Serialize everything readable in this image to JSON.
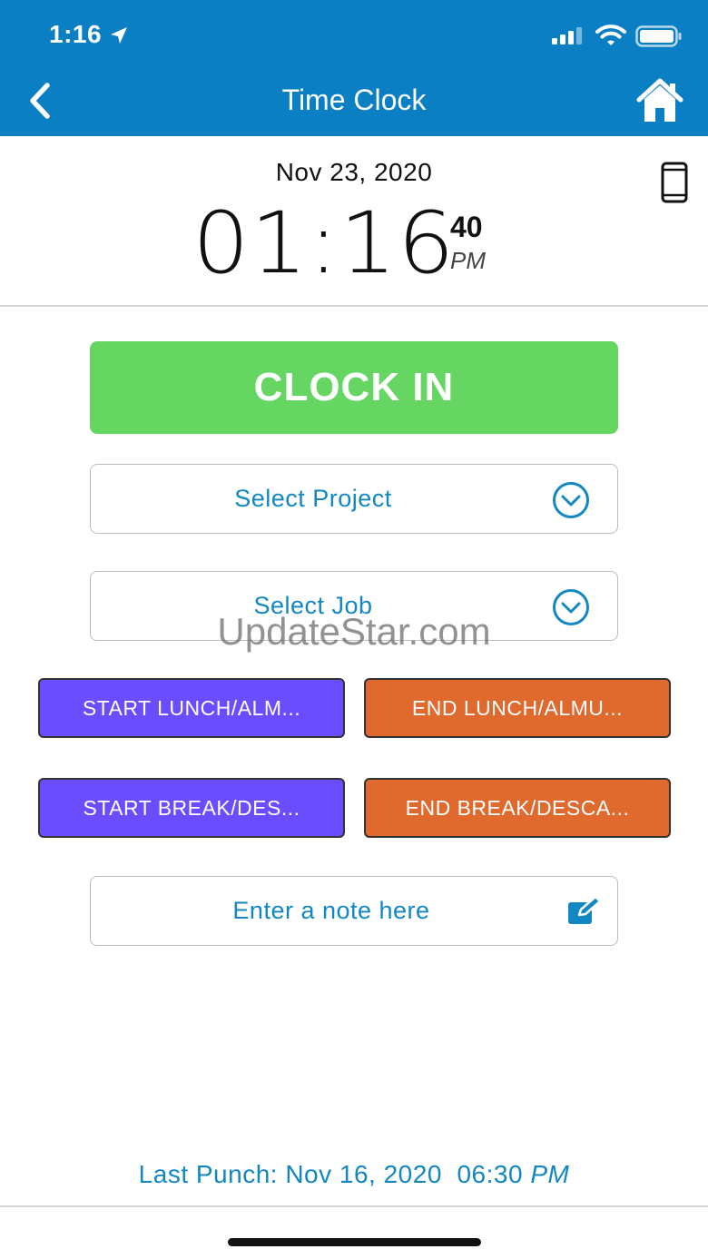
{
  "status_bar": {
    "time": "1:16"
  },
  "header": {
    "title": "Time Clock"
  },
  "clock": {
    "date": "Nov 23, 2020",
    "time": "01:16",
    "seconds": "40",
    "ampm": "PM"
  },
  "actions": {
    "clock_in": "CLOCK IN",
    "select_project": "Select Project",
    "select_job": "Select Job",
    "start_lunch": "START LUNCH/ALM...",
    "end_lunch": "END LUNCH/ALMU...",
    "start_break": "START BREAK/DES...",
    "end_break": "END BREAK/DESCA...",
    "note_placeholder": "Enter a note here"
  },
  "last_punch": {
    "label": "Last Punch:",
    "date": "Nov 16, 2020",
    "time": "06:30",
    "ampm": "PM"
  },
  "watermark": "UpdateStar.com",
  "colors": {
    "header": "#0a7fc3",
    "clock_in": "#66d663",
    "start_buttons": "#6a4dff",
    "end_buttons": "#e0692e",
    "link_text": "#1287c2"
  }
}
